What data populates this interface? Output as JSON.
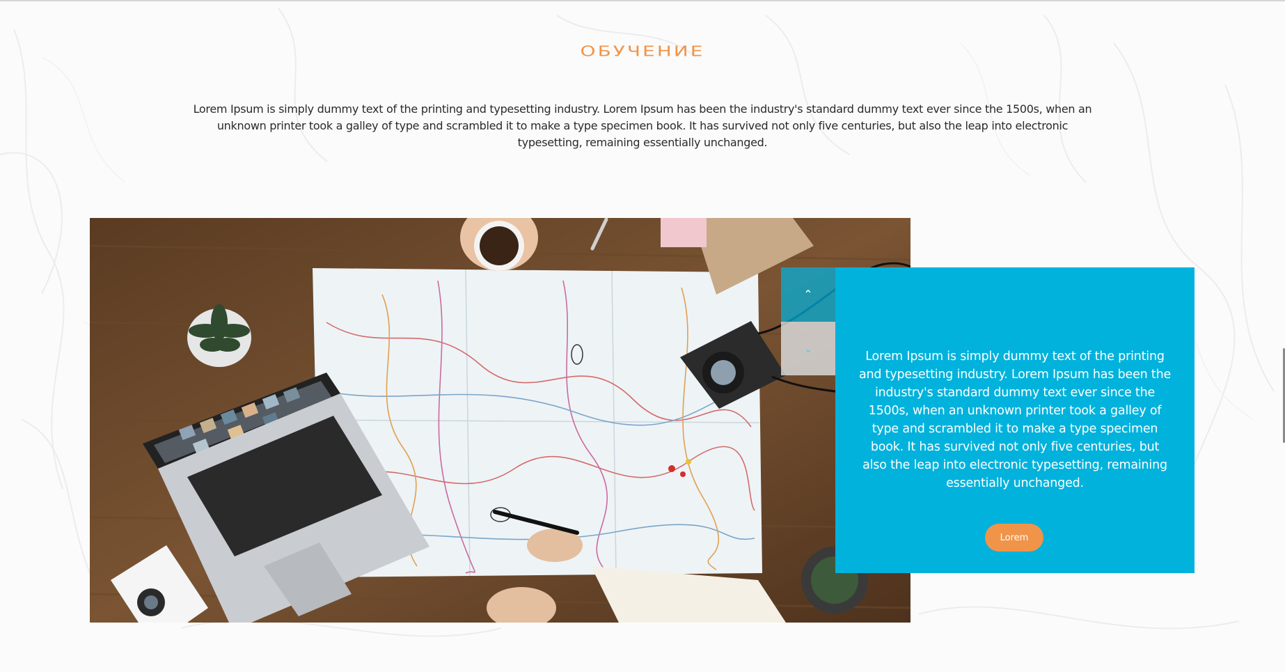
{
  "section": {
    "title": "ОБУЧЕНИЕ",
    "intro": "Lorem Ipsum is simply dummy text of the printing and typesetting industry. Lorem Ipsum has been the industry's standard dummy text ever since the 1500s, when an unknown printer took a galley of type and scrambled it to make a type specimen book. It has survived not only five centuries, but also the leap into electronic typesetting, remaining essentially unchanged."
  },
  "slider": {
    "up_icon": "chevron-up-icon",
    "down_icon": "chevron-down-icon"
  },
  "card": {
    "text": "Lorem Ipsum is simply dummy text of the printing and typesetting industry. Lorem Ipsum has been the industry's standard dummy text ever since the 1500s, when an unknown printer took a galley of type and scrambled it to make a type specimen book. It has survived not only five centuries, but also the leap into electronic typesetting, remaining essentially unchanged.",
    "button_label": "Lorem"
  },
  "colors": {
    "accent_orange": "#f0944a",
    "card_blue": "#00b2dc",
    "text_dark": "#2a2a2a"
  }
}
